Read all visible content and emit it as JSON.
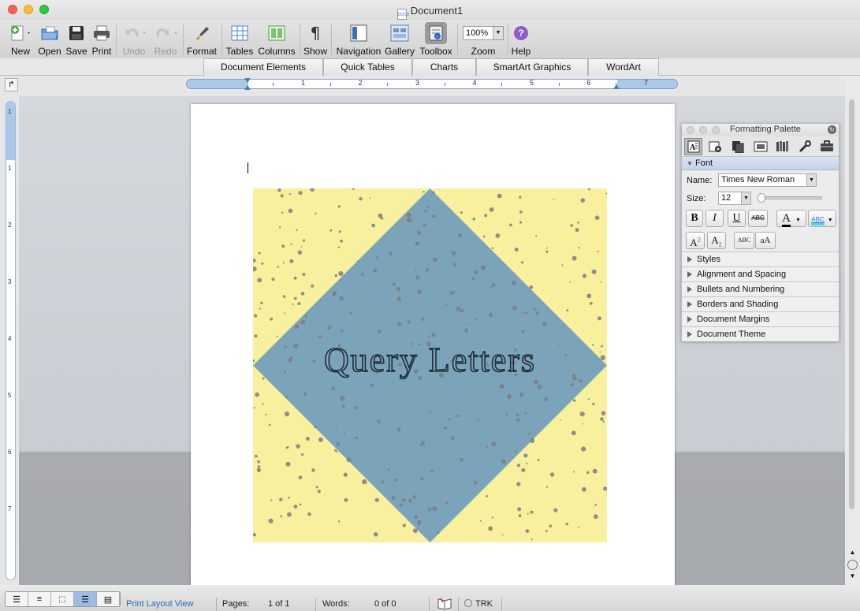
{
  "window": {
    "title": "Document1"
  },
  "toolbar": {
    "new": "New",
    "open": "Open",
    "save": "Save",
    "print": "Print",
    "undo": "Undo",
    "redo": "Redo",
    "format": "Format",
    "tables": "Tables",
    "columns": "Columns",
    "show": "Show",
    "navigation": "Navigation",
    "gallery": "Gallery",
    "toolbox": "Toolbox",
    "zoom_value": "100%",
    "zoom": "Zoom",
    "help": "Help"
  },
  "ribbon": {
    "tabs": [
      "Document Elements",
      "Quick Tables",
      "Charts",
      "SmartArt Graphics",
      "WordArt"
    ]
  },
  "ruler": {
    "numbers": [
      "1",
      "2",
      "3",
      "4",
      "5",
      "6",
      "7"
    ]
  },
  "vruler": {
    "numbers": [
      "1",
      "1",
      "2",
      "3",
      "4",
      "5",
      "6",
      "7"
    ]
  },
  "document": {
    "art_text": "Query Letters"
  },
  "palette": {
    "title": "Formatting Palette",
    "font_section": "Font",
    "name_label": "Name:",
    "font_name": "Times New Roman",
    "size_label": "Size:",
    "font_size": "12",
    "bold": "B",
    "italic": "I",
    "underline": "U",
    "strike": "ABC",
    "sections": [
      "Styles",
      "Alignment and Spacing",
      "Bullets and Numbering",
      "Borders and Shading",
      "Document Margins",
      "Document Theme"
    ]
  },
  "status": {
    "view": "Print Layout View",
    "pages_label": "Pages:",
    "pages_value": "1 of 1",
    "words_label": "Words:",
    "words_value": "0 of 0",
    "trk": "TRK"
  },
  "colors": {
    "art_background": "#f8f09c",
    "diamond": "#7ba4bb",
    "speckle": "#7c7e82",
    "art_text": "#1e2d36"
  }
}
